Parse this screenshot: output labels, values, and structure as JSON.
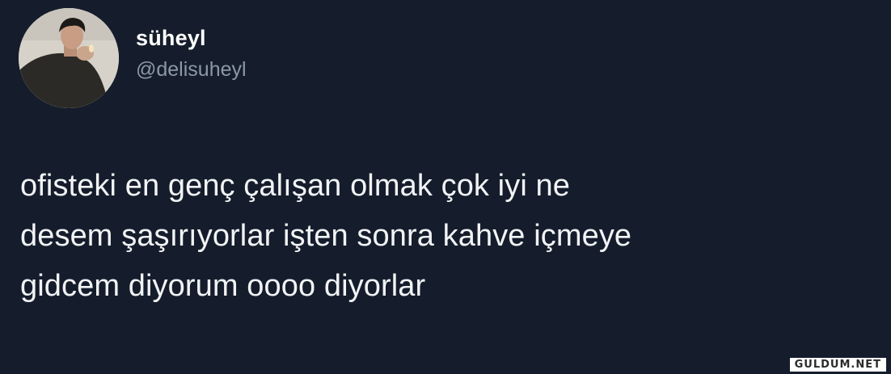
{
  "user": {
    "display_name": "süheyl",
    "handle": "@delisuheyl",
    "avatar_icon": "profile-photo"
  },
  "tweet": {
    "text": "ofisteki en genç çalışan olmak çok iyi ne\ndesem şaşırıyorlar işten sonra kahve içmeye\ngidcem diyorum oooo diyorlar"
  },
  "watermark": {
    "text": "GULDUM.NET"
  },
  "colors": {
    "background": "#151d2c",
    "text": "#f1f3f5",
    "handle": "#8b98a5"
  }
}
